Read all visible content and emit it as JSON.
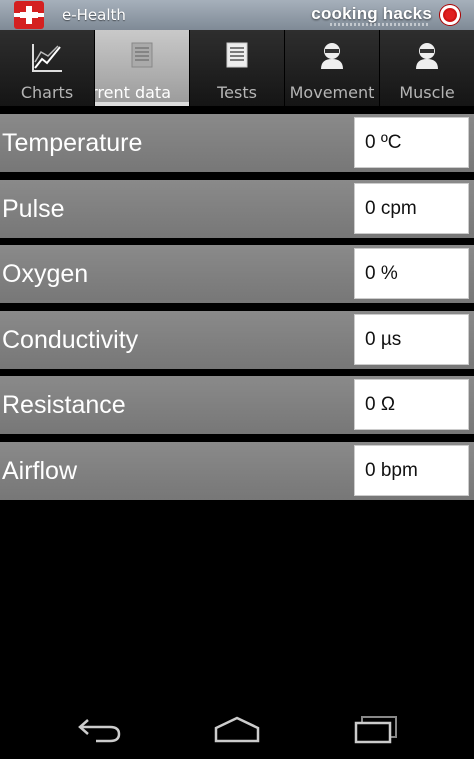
{
  "app": {
    "title": "e-Health",
    "brand": "cooking hacks"
  },
  "tabs": [
    {
      "label": "Charts",
      "icon": "chart-icon",
      "active": false
    },
    {
      "label": "rrent data",
      "icon": "list-icon",
      "active": true
    },
    {
      "label": "Tests",
      "icon": "document-icon",
      "active": false
    },
    {
      "label": "Movement",
      "icon": "person-icon",
      "active": false
    },
    {
      "label": "Muscle",
      "icon": "person-icon",
      "active": false
    }
  ],
  "rows": [
    {
      "label": "Temperature",
      "value": "0 ºC"
    },
    {
      "label": "Pulse",
      "value": "0 cpm"
    },
    {
      "label": "Oxygen",
      "value": "0 %"
    },
    {
      "label": "Conductivity",
      "value": "0 µs"
    },
    {
      "label": "Resistance",
      "value": "0 Ω"
    },
    {
      "label": "Airflow",
      "value": "0 bpm"
    }
  ],
  "navbar": {
    "icons": [
      "back-icon",
      "home-icon",
      "recents-icon"
    ]
  }
}
